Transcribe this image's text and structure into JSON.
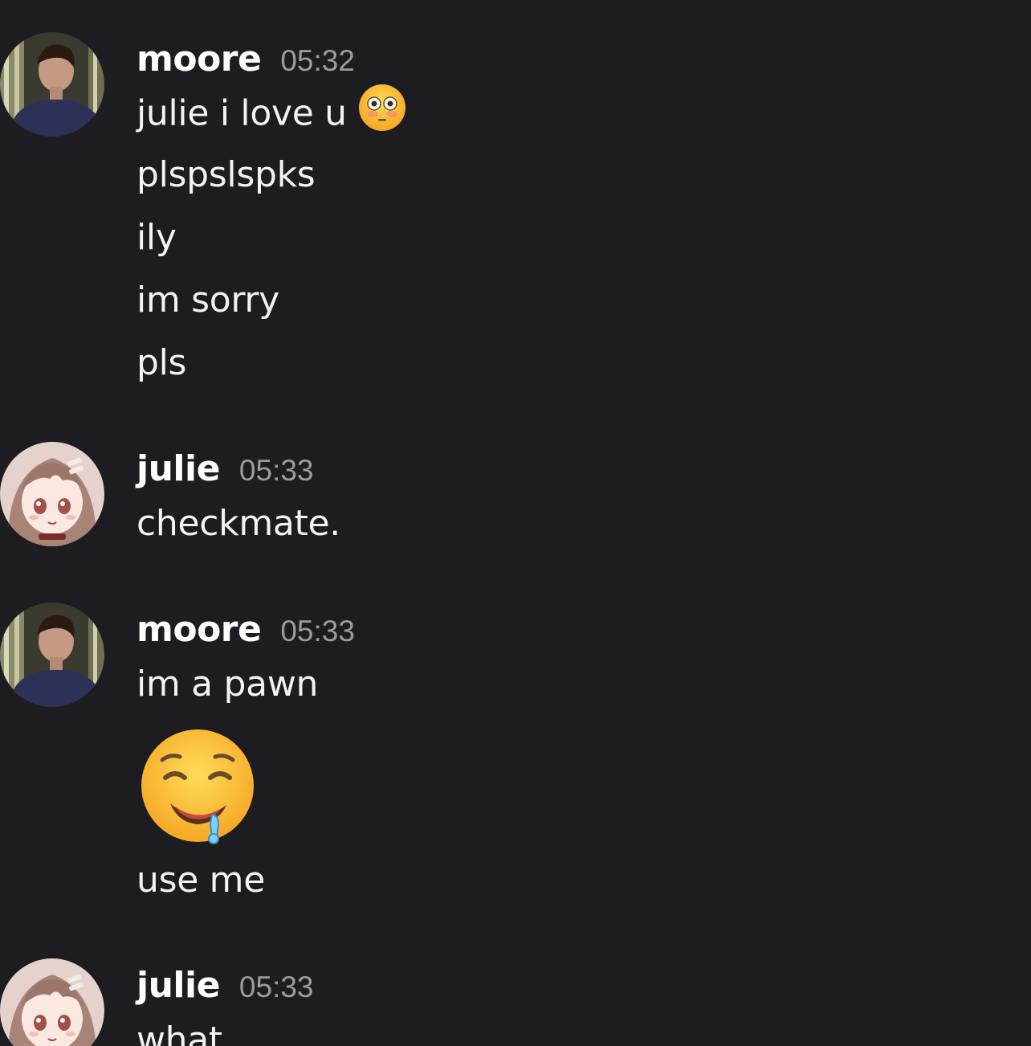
{
  "messages": [
    {
      "user": "moore",
      "time": "05:32",
      "avatar": "moore-avatar",
      "lines": [
        "julie i love u",
        "plspslspks",
        "ily",
        "im sorry",
        "pls"
      ],
      "inline_emoji": "flushed-face-emoji"
    },
    {
      "user": "julie",
      "time": "05:33",
      "avatar": "julie-avatar",
      "lines": [
        "checkmate."
      ]
    },
    {
      "user": "moore",
      "time": "05:33",
      "avatar": "moore-avatar",
      "lines": [
        "im a pawn",
        "use me"
      ],
      "big_emoji": "drooling-face-emoji"
    },
    {
      "user": "julie",
      "time": "05:33",
      "avatar": "julie-avatar",
      "lines": [
        "what"
      ]
    }
  ],
  "colors": {
    "background": "#1c1c21",
    "username": "#ffffff",
    "timestamp": "#9a9ca2",
    "text": "#f2f3f5"
  }
}
